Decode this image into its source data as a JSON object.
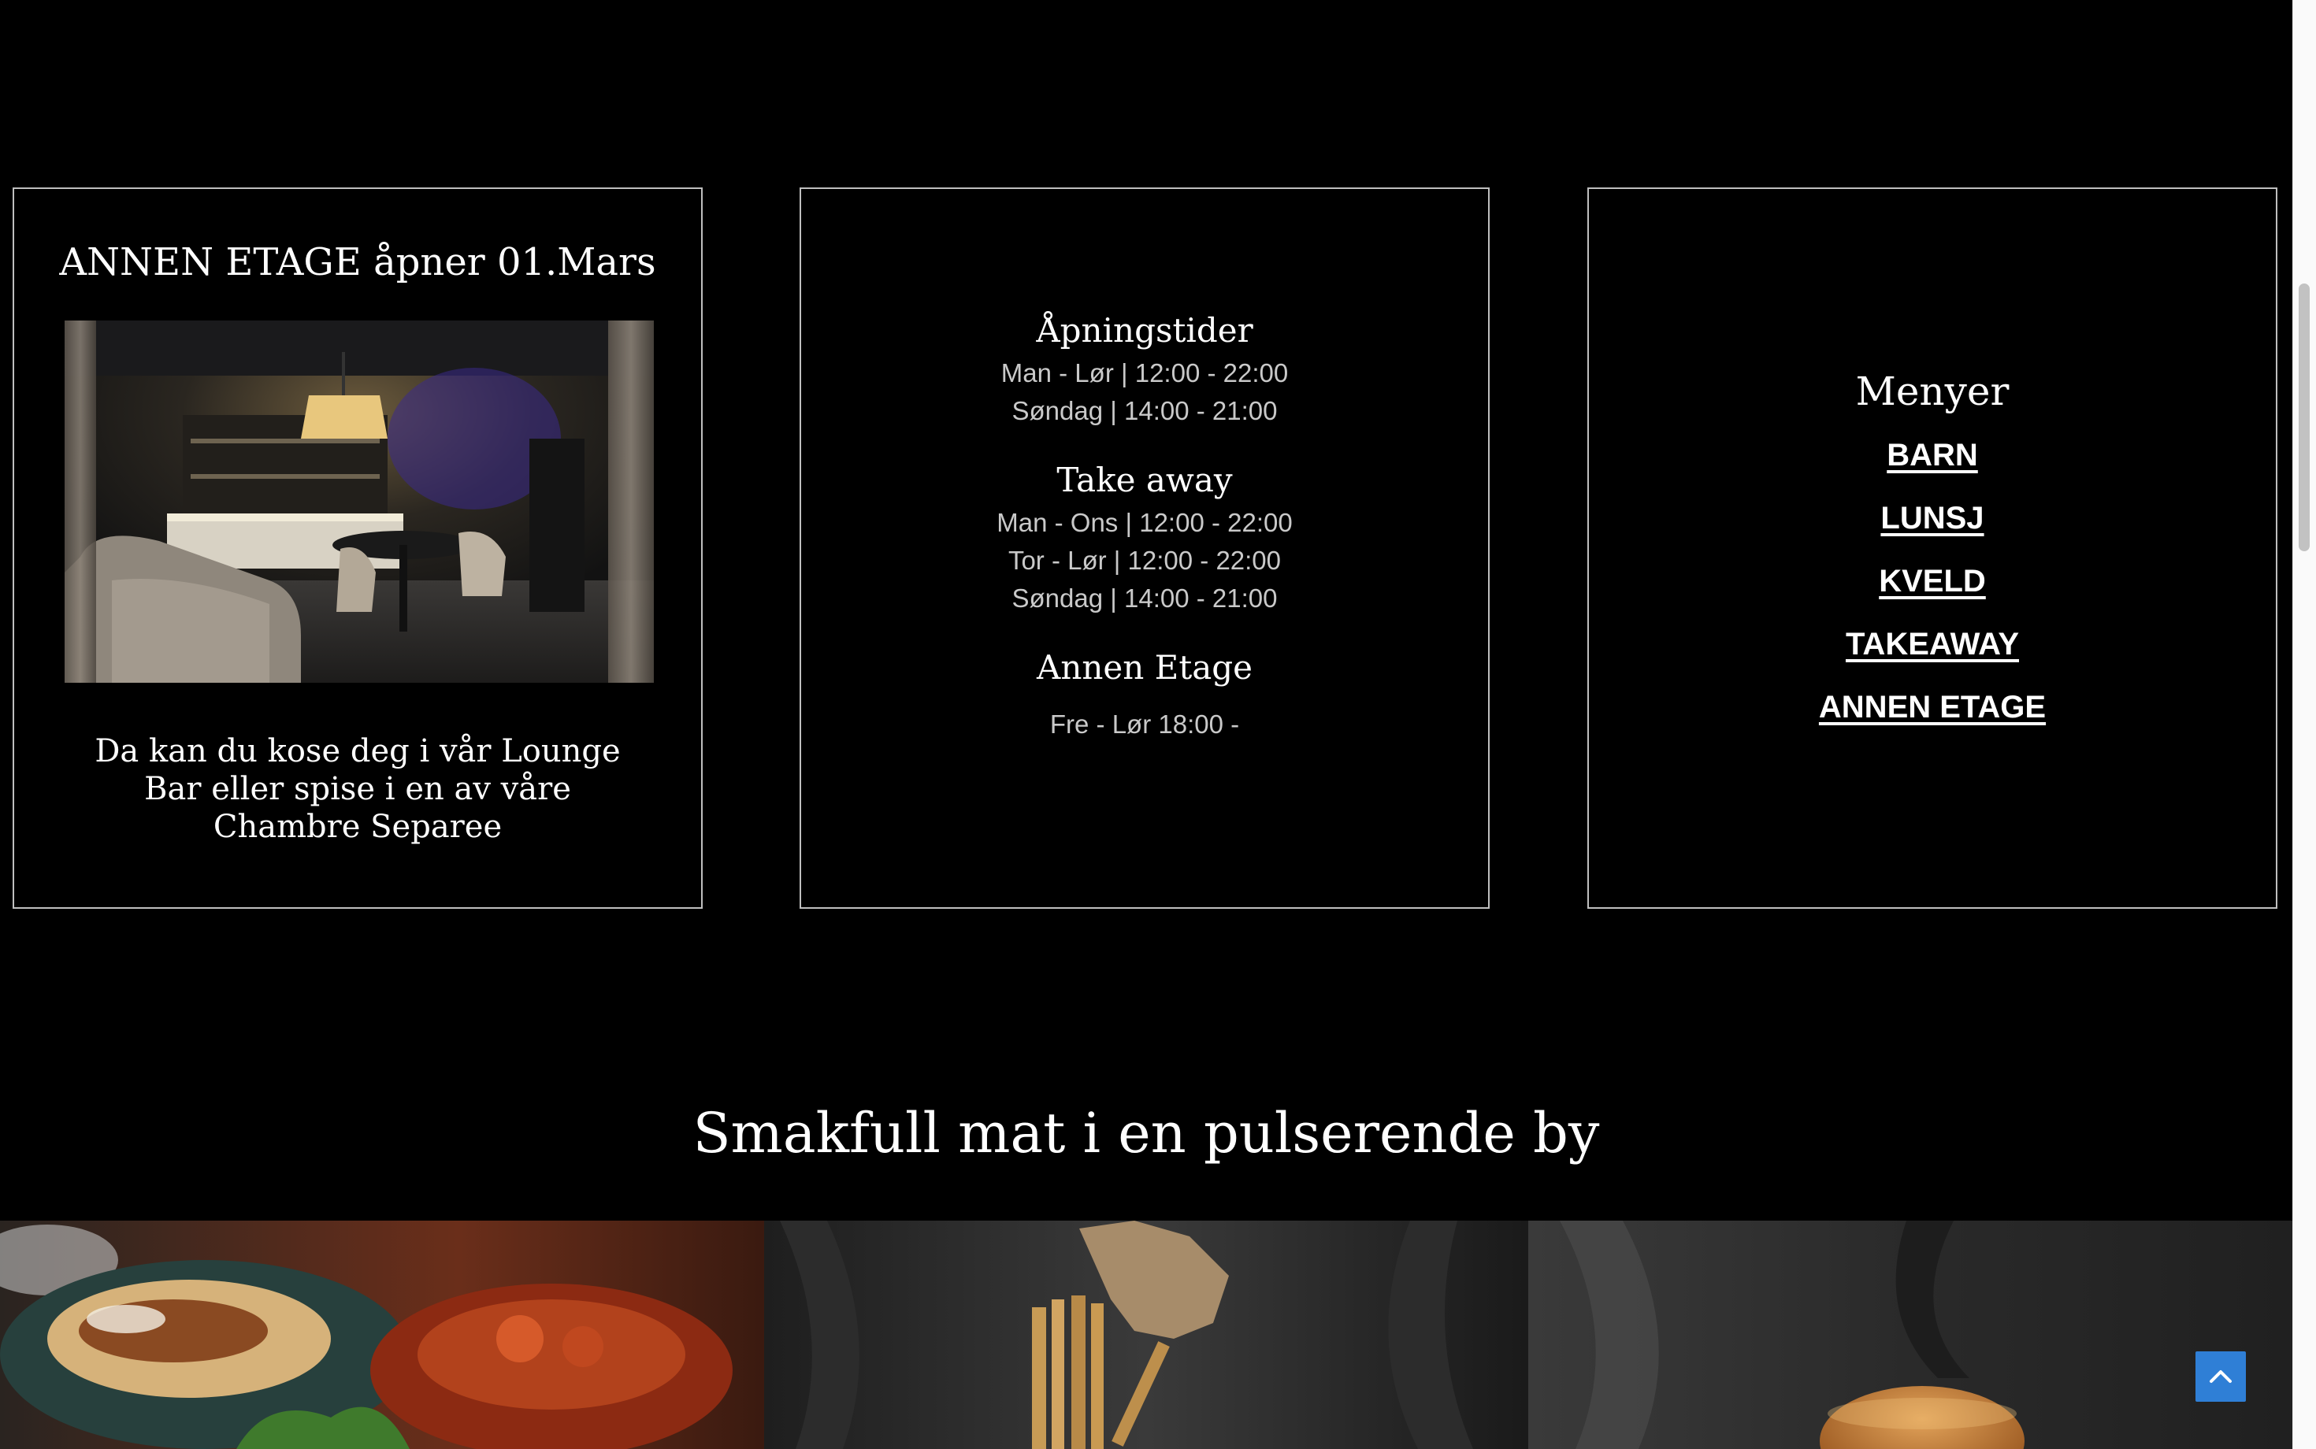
{
  "lounge_card": {
    "title": "ANNEN ETAGE åpner 01.Mars",
    "description": "Da kan du kose deg i vår Lounge Bar eller spise i en av våre Chambre Separee"
  },
  "hours_card": {
    "opening_heading": "Åpningstider",
    "opening_lines": [
      "Man - Lør | 12:00 - 22:00",
      "Søndag | 14:00 - 21:00"
    ],
    "takeaway_heading": "Take away",
    "takeaway_lines": [
      "Man - Ons | 12:00 - 22:00",
      "Tor - Lør | 12:00 - 22:00",
      "Søndag | 14:00 - 21:00"
    ],
    "annen_heading": "Annen Etage",
    "annen_lines": [
      "Fre - Lør 18:00 -"
    ]
  },
  "menu_card": {
    "heading": "Menyer",
    "links": [
      "BARN",
      "LUNSJ",
      "KVELD",
      "TAKEAWAY",
      "ANNEN ETAGE"
    ]
  },
  "section": {
    "title": "Smakfull mat i en pulserende by"
  },
  "scroll_top": {
    "icon": "chevron-up-icon",
    "color": "#2f7fd6"
  },
  "colors": {
    "background": "#000000",
    "card_border": "#bfbfbf",
    "text": "#ffffff",
    "muted_text": "#c9c9c9",
    "accent": "#2f7fd6"
  }
}
